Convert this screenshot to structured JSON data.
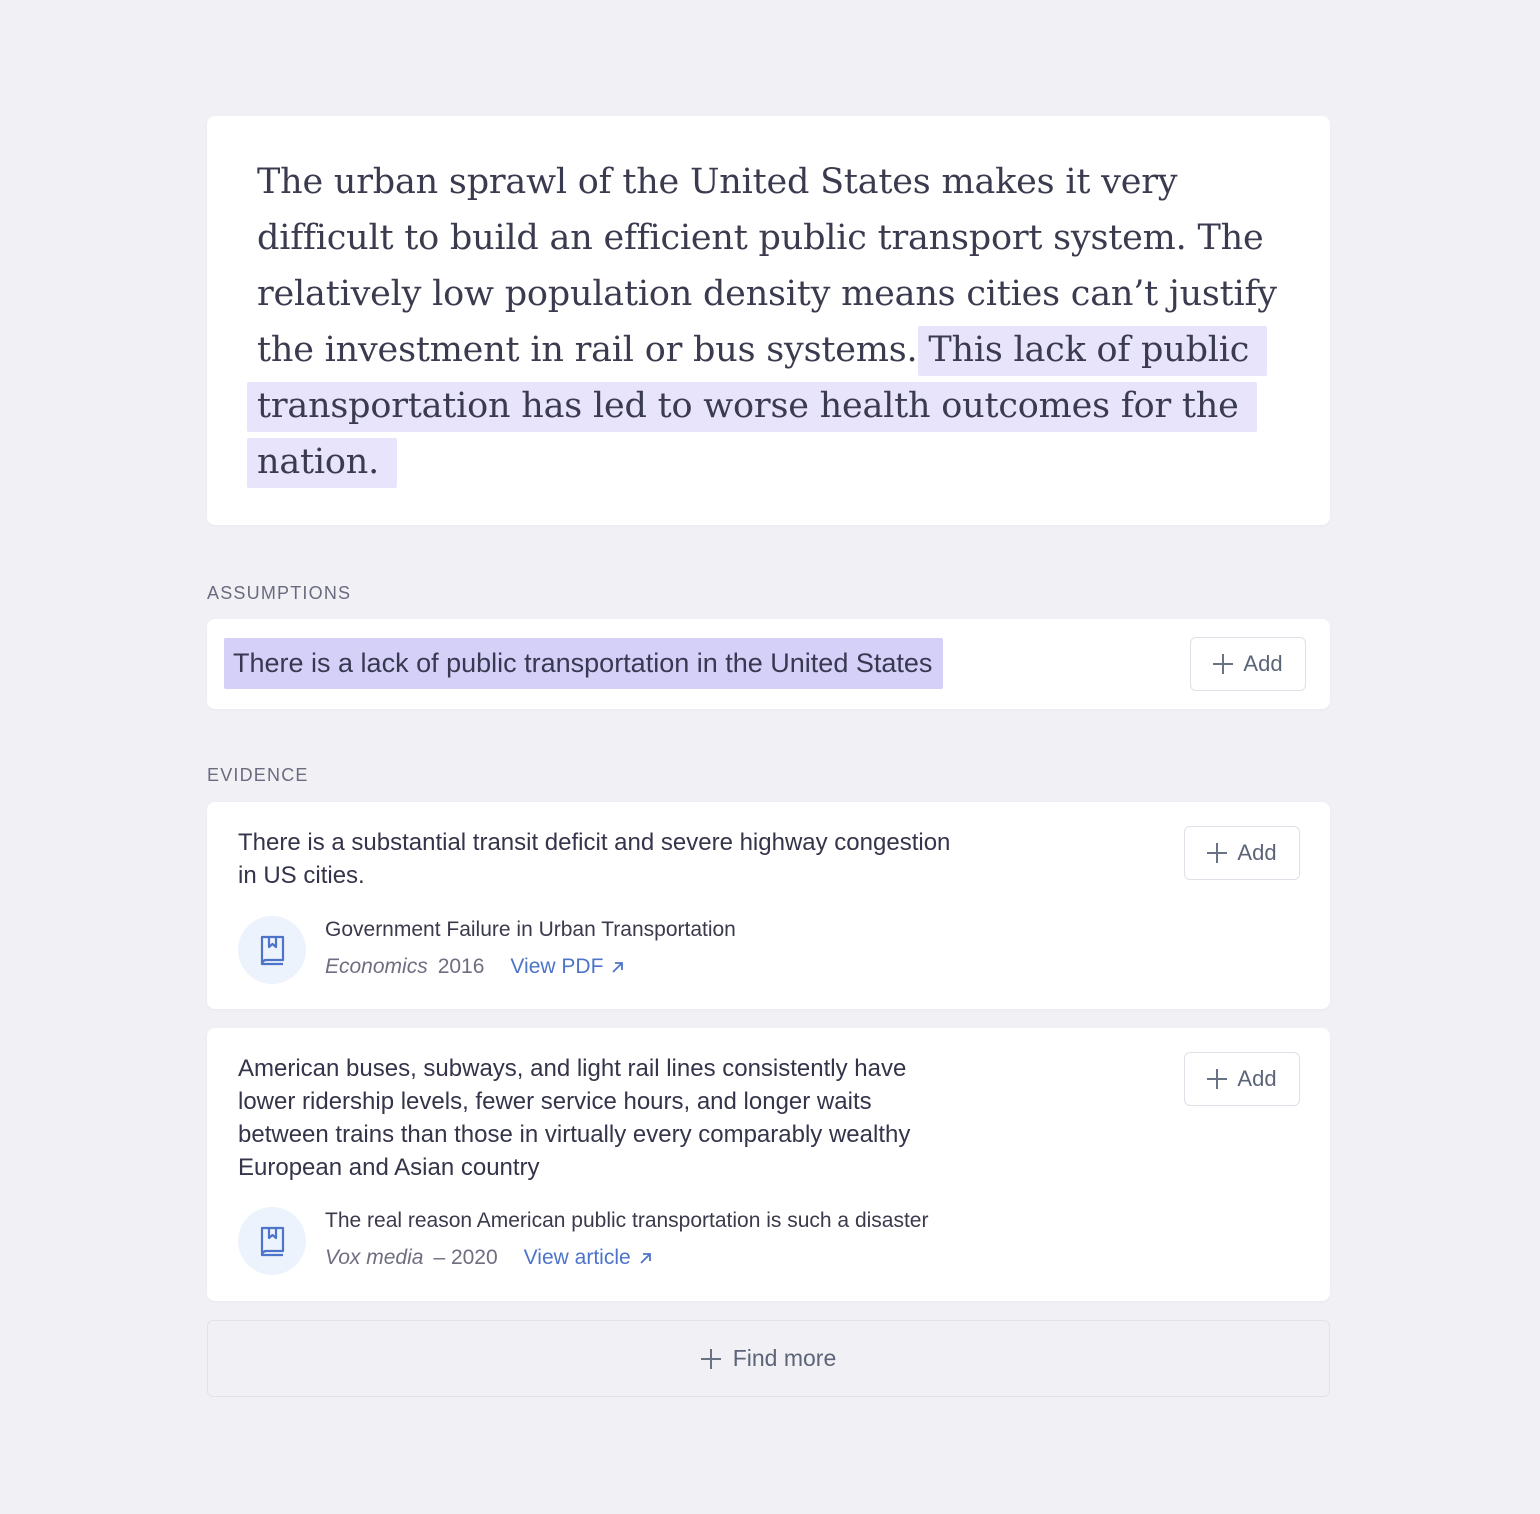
{
  "passage": {
    "plain": "The urban sprawl of the United States makes it very difficult to build an efficient public transport system. The relatively low population density means cities can’t justify the investment in rail or bus systems. ",
    "highlighted": "This lack of public transportation has led to worse health outcomes for the nation.",
    "highlight_color": "#e7e4fb"
  },
  "assumptions": {
    "label": "ASSUMPTIONS",
    "items": [
      {
        "text": "There is a lack of public transportation in the United States",
        "add_label": "Add",
        "add_icon": "plus-icon"
      }
    ],
    "highlight_color": "#d4d0f8"
  },
  "evidence": {
    "label": "EVIDENCE",
    "items": [
      {
        "text": "There is a substantial transit deficit and severe highway congestion in US cities.",
        "add_label": "Add",
        "source_icon": "book-icon",
        "source_title": "Government Failure in Urban Transportation",
        "publication": "Economics",
        "year": "2016",
        "link_label": "View PDF",
        "link_icon": "arrow-up-right-icon"
      },
      {
        "text": "American buses, subways, and light rail lines consistently have lower ridership levels, fewer service hours, and longer waits between trains than those in virtually every comparably wealthy European and Asian country",
        "add_label": "Add",
        "source_icon": "book-icon",
        "source_title": "The real reason American public transportation is such a disaster",
        "publication": "Vox media",
        "year": "– 2020",
        "link_label": "View article",
        "link_icon": "arrow-up-right-icon"
      }
    ]
  },
  "find_more": {
    "label": "Find more",
    "icon": "plus-icon"
  },
  "colors": {
    "background": "#f0f0f5",
    "card": "#ffffff",
    "link": "#4d74c9",
    "icon_circle": "#edf3fc"
  }
}
